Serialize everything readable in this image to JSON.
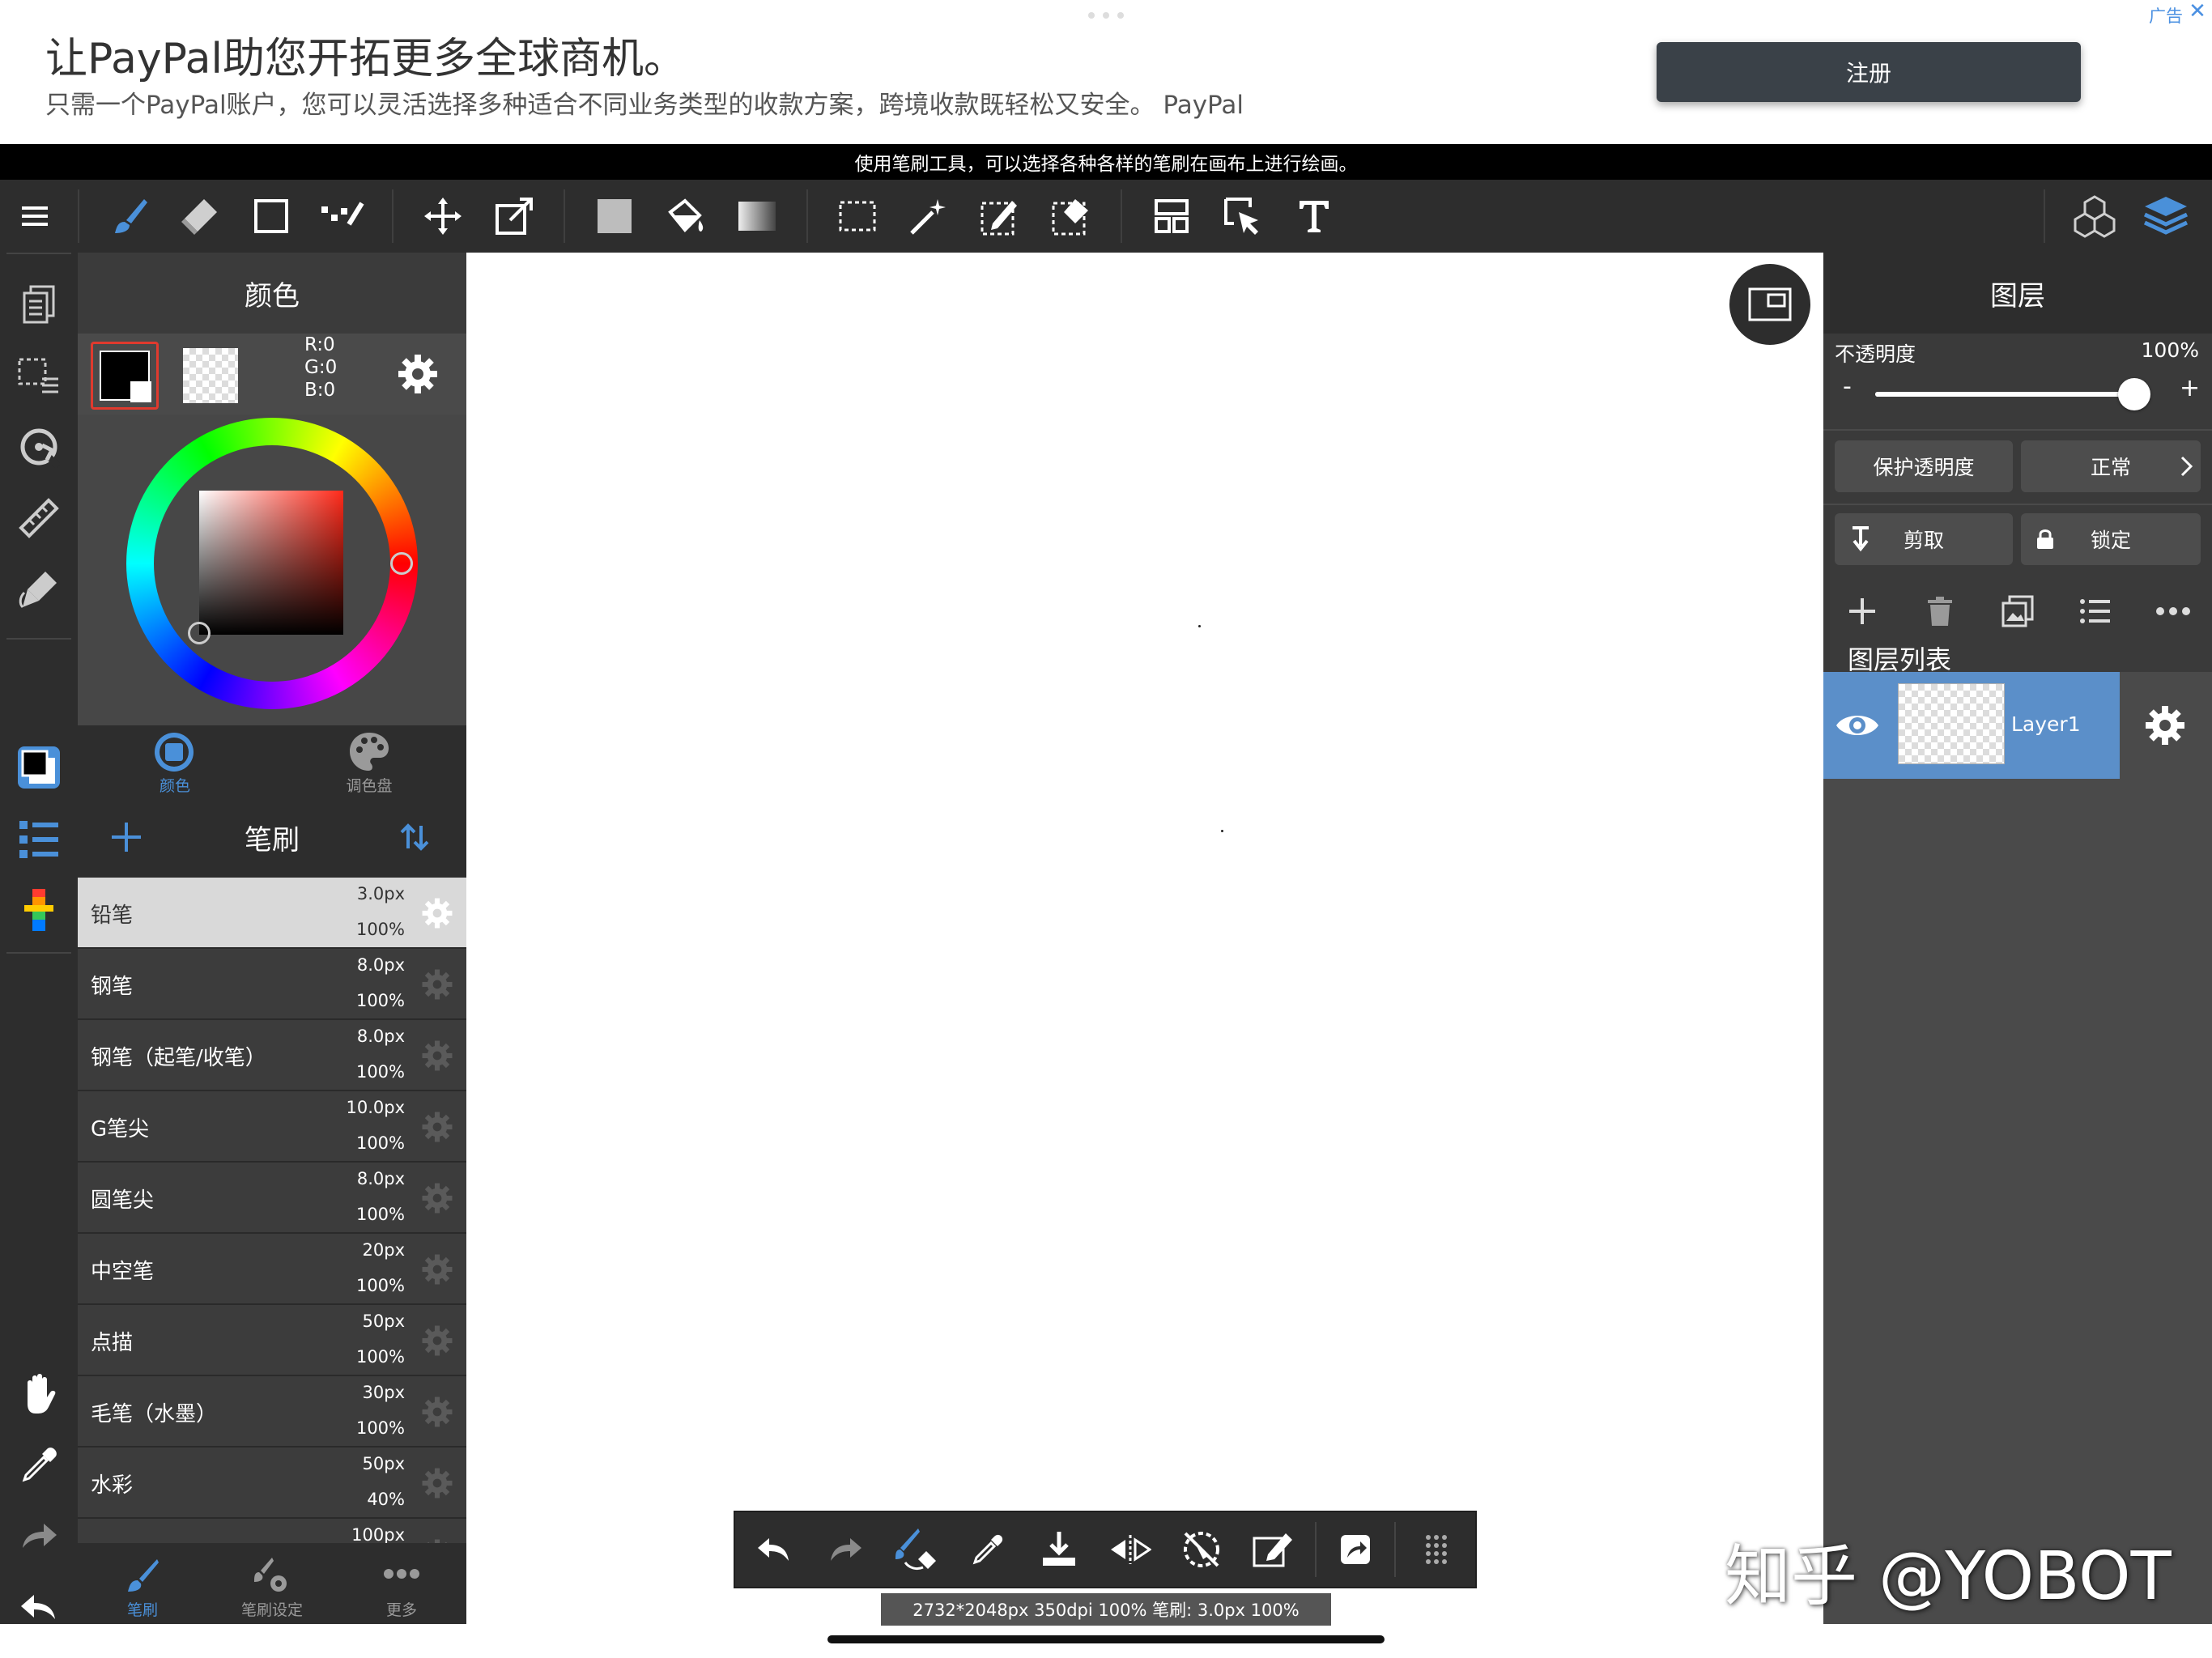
{
  "ad": {
    "title": "让PayPal助您开拓更多全球商机。",
    "description": "只需一个PayPal账户，您可以灵活选择多种适合不同业务类型的收款方案，跨境收款既轻松又安全。 PayPal",
    "button_label": "注册",
    "tag": "广告",
    "close": "✕"
  },
  "hint": "使用笔刷工具，可以选择各种各样的笔刷在画布上进行绘画。",
  "toolbar": {
    "icons": [
      "menu-icon",
      "brush-tool-icon",
      "eraser-tool-icon",
      "shape-tool-icon",
      "dot-tool-icon",
      "move-tool-icon",
      "transform-tool-icon",
      "fill-color-icon",
      "bucket-tool-icon",
      "gradient-tool-icon",
      "select-rect-icon",
      "magic-wand-icon",
      "select-pen-icon",
      "select-eraser-icon",
      "layout-icon",
      "select-object-icon",
      "text-tool-icon",
      "materials-icon",
      "layers-icon"
    ],
    "accent": "#4a90d9"
  },
  "color_panel": {
    "title": "颜色",
    "rgb": {
      "r": "R:0",
      "g": "G:0",
      "b": "B:0"
    },
    "tabs": [
      {
        "label": "颜色",
        "active": true
      },
      {
        "label": "调色盘",
        "active": false
      }
    ],
    "primary_color": "#000000",
    "hue_color": "#ff2a1a"
  },
  "brush_panel": {
    "title": "笔刷",
    "brushes": [
      {
        "name": "铅笔",
        "size": "3.0px",
        "opacity": "100%",
        "selected": true
      },
      {
        "name": "钢笔",
        "size": "8.0px",
        "opacity": "100%",
        "selected": false
      },
      {
        "name": "钢笔（起笔/收笔）",
        "size": "8.0px",
        "opacity": "100%",
        "selected": false
      },
      {
        "name": "G笔尖",
        "size": "10.0px",
        "opacity": "100%",
        "selected": false
      },
      {
        "name": "圆笔尖",
        "size": "8.0px",
        "opacity": "100%",
        "selected": false
      },
      {
        "name": "中空笔",
        "size": "20px",
        "opacity": "100%",
        "selected": false
      },
      {
        "name": "点描",
        "size": "50px",
        "opacity": "100%",
        "selected": false
      },
      {
        "name": "毛笔（水墨）",
        "size": "30px",
        "opacity": "100%",
        "selected": false
      },
      {
        "name": "水彩",
        "size": "50px",
        "opacity": "40%",
        "selected": false
      },
      {
        "name": "",
        "size": "100px",
        "opacity": "",
        "selected": false
      }
    ],
    "tabs": [
      {
        "label": "笔刷",
        "active": true
      },
      {
        "label": "笔刷设定",
        "active": false
      },
      {
        "label": "更多",
        "active": false
      }
    ]
  },
  "layer_panel": {
    "title": "图层",
    "opacity_label": "不透明度",
    "opacity_value": "100%",
    "opacity_level": 1.0,
    "minus": "-",
    "plus": "+",
    "protect_alpha": "保护透明度",
    "blend_mode": "正常",
    "clip": "剪取",
    "lock": "锁定",
    "list_title": "图层列表",
    "layers": [
      {
        "name": "Layer1",
        "visible": true,
        "selected": true
      }
    ]
  },
  "status": "2732*2048px 350dpi 100% 笔刷: 3.0px 100%",
  "watermark": "知乎 @YOBOT"
}
